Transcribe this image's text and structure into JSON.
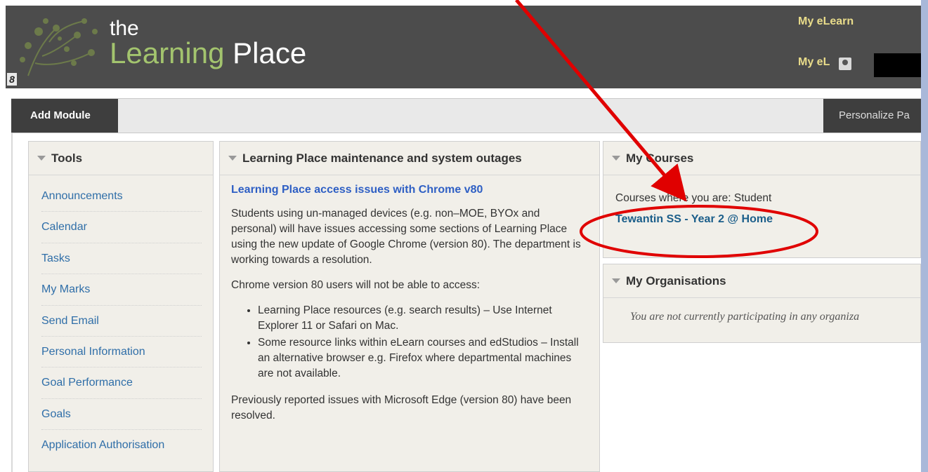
{
  "header": {
    "brand_the": "the",
    "brand_learning": "Learning",
    "brand_place": "Place",
    "corner_label": "8",
    "top_link_1": "My eLearn",
    "top_link_2": "My eL"
  },
  "toolbar": {
    "add_module_label": "Add Module",
    "personalize_label": "Personalize Pa"
  },
  "tools": {
    "title": "Tools",
    "items": [
      "Announcements",
      "Calendar",
      "Tasks",
      "My Marks",
      "Send Email",
      "Personal Information",
      "Goal Performance",
      "Goals",
      "Application Authorisation"
    ]
  },
  "maintenance": {
    "title": "Learning Place maintenance and system outages",
    "lead": "Learning Place access issues with Chrome v80",
    "para1": "Students using un-managed devices (e.g. non–MOE, BYOx and personal) will have issues accessing some sections of Learning Place using the new update of Google Chrome (version 80). The department is working towards a resolution.",
    "para2": "Chrome version 80 users will not be able to access:",
    "bullets": [
      "Learning Place resources (e.g. search results) – Use Internet Explorer 11 or Safari on Mac.",
      "Some resource links within eLearn courses and edStudios – Install an alternative browser e.g. Firefox where departmental machines are not available."
    ],
    "para3": "Previously reported issues with Microsoft Edge (version 80) have been resolved."
  },
  "courses": {
    "title": "My Courses",
    "subtitle": "Courses where you are: Student",
    "course": "Tewantin SS - Year 2 @ Home"
  },
  "organisations": {
    "title": "My Organisations",
    "empty_text": "You are not currently participating in any organiza"
  },
  "colors": {
    "header_bg": "#4c4c4c",
    "brand_green": "#a3c46e",
    "link_gold": "#e9dc8a",
    "link_blue": "#2f6ea8",
    "annotation_red": "#e00000"
  }
}
